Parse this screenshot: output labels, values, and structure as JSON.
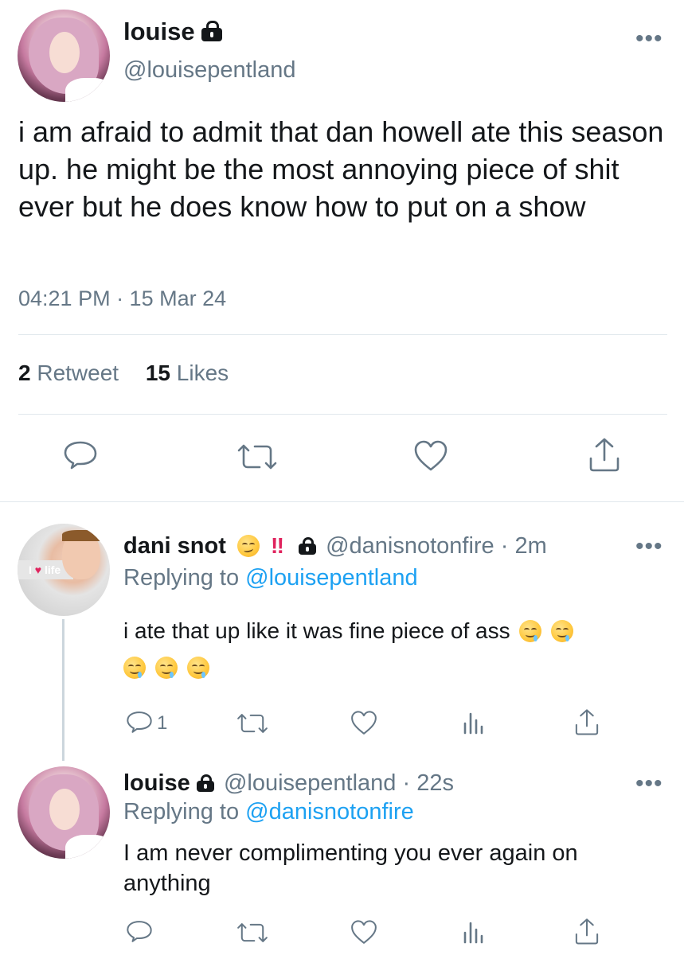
{
  "main_tweet": {
    "display_name": "louise",
    "handle": "@louisepentland",
    "text": "i am afraid to admit that dan howell ate this season up. he might be the most annoying piece of shit ever but he does know how to put on a show",
    "timestamp": "04:21 PM · 15 Mar 24",
    "retweet_count": "2",
    "retweet_label": "Retweet",
    "like_count": "15",
    "like_label": "Likes",
    "more_label": "•••",
    "action_icons": [
      "reply-icon",
      "retweet-icon",
      "like-icon",
      "share-icon"
    ]
  },
  "replies": [
    {
      "display_name": "dani snot",
      "emoji_badges": "‼",
      "handle_time": "@danisnotonfire · 2m",
      "replying_prefix": "Replying to",
      "replying_to": "@louisepentland",
      "text": "i ate that up like it was fine piece of ass",
      "avatar_sticker": "life",
      "reply_count": "1",
      "more_label": "•••"
    },
    {
      "display_name": "louise",
      "handle_time": "@louisepentland · 22s",
      "replying_prefix": "Replying to",
      "replying_to": "@danisnotonfire",
      "text": "I am never complimenting you ever again on anything",
      "reply_count": "",
      "more_label": "•••"
    }
  ],
  "colors": {
    "text": "#14171a",
    "secondary": "#657786",
    "link": "#1da1f2",
    "divider": "#e1e8ed"
  }
}
